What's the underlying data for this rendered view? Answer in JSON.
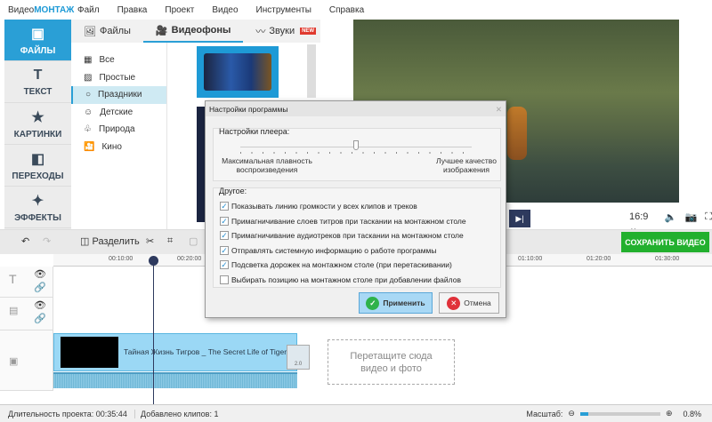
{
  "app": {
    "logo_prefix": "Видео",
    "logo_suffix": "МОНТАЖ"
  },
  "menu": [
    "Файл",
    "Правка",
    "Проект",
    "Видео",
    "Инструменты",
    "Справка"
  ],
  "sidebar": [
    {
      "label": "ФАЙЛЫ",
      "icon": "▣"
    },
    {
      "label": "ТЕКСТ",
      "icon": "T"
    },
    {
      "label": "КАРТИНКИ",
      "icon": "★"
    },
    {
      "label": "ПЕРЕХОДЫ",
      "icon": "◧"
    },
    {
      "label": "ЭФФЕКТЫ",
      "icon": "✦"
    }
  ],
  "tabs": [
    {
      "label": "Файлы"
    },
    {
      "label": "Видеофоны"
    },
    {
      "label": "Звуки",
      "badge": "NEW"
    }
  ],
  "categories": [
    "Все",
    "Простые",
    "Праздники",
    "Детские",
    "Природа",
    "Кино"
  ],
  "player": {
    "aspect": "16:9 ⌄"
  },
  "toolbar": {
    "split": "Разделить",
    "save": "СОХРАНИТЬ ВИДЕО"
  },
  "ruler": [
    "00:10:00",
    "00:20:00",
    "01:10:00",
    "01:20:00",
    "01:30:00"
  ],
  "clip": {
    "title": "Тайная Жизнь Тигров _ The Secret Life of Tigers _",
    "transition": "2.0"
  },
  "drop": {
    "line1": "Перетащите сюда",
    "line2": "видео и фото"
  },
  "status": {
    "duration": "Длительность проекта:  00:35:44",
    "clips": "Добавлено клипов: 1",
    "scale_label": "Масштаб:",
    "scale_value": "0.8%"
  },
  "scale_fraction": 0.1,
  "dialog": {
    "title": "Настройки программы",
    "player_group": "Настройки плеера:",
    "slider_left": "Максимальная плавность воспроизведения",
    "slider_right": "Лучшее качество изображения",
    "slider_value": 0.5,
    "other_group": "Другое:",
    "options": [
      {
        "label": "Показывать линию громкости у всех клипов и треков",
        "checked": true
      },
      {
        "label": "Примагничивание слоев титров при таскании на монтажном столе",
        "checked": true
      },
      {
        "label": "Примагничивание аудиотреков при таскании на монтажном столе",
        "checked": true
      },
      {
        "label": "Отправлять системную информацию о работе программы",
        "checked": true
      },
      {
        "label": "Подсветка дорожек на монтажном столе (при перетаскивании)",
        "checked": true
      },
      {
        "label": "Выбирать позицию на монтажном столе при добавлении файлов",
        "checked": false
      }
    ],
    "apply": "Применить",
    "cancel": "Отмена"
  }
}
